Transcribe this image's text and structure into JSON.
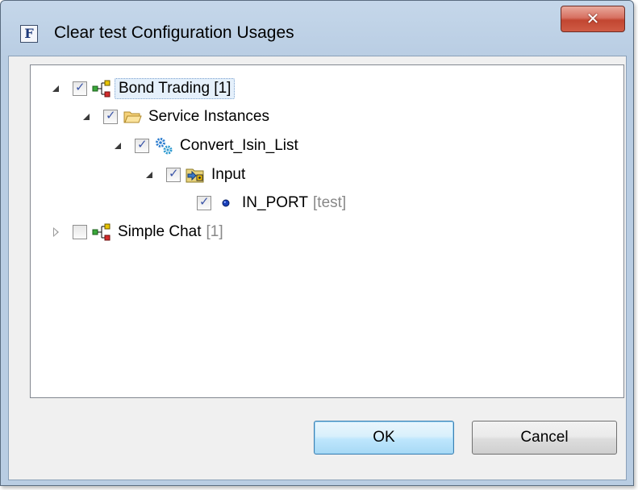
{
  "window": {
    "title": "Clear test Configuration Usages",
    "app_icon": "F",
    "close_glyph": "✕"
  },
  "tree": {
    "nodes": [
      {
        "label": "Bond Trading [1]",
        "suffix": "",
        "checked": true,
        "expanded": true,
        "icon": "project-icon",
        "selected": true
      },
      {
        "label": "Service Instances",
        "suffix": "",
        "checked": true,
        "expanded": true,
        "icon": "folder-open-icon"
      },
      {
        "label": "Convert_Isin_List",
        "suffix": "",
        "checked": true,
        "expanded": true,
        "icon": "gears-icon"
      },
      {
        "label": "Input",
        "suffix": "",
        "checked": true,
        "expanded": true,
        "icon": "input-folder-icon"
      },
      {
        "label": "IN_PORT",
        "suffix": "[test]",
        "checked": true,
        "expanded": null,
        "icon": "port-dot-icon"
      },
      {
        "label": "Simple Chat",
        "suffix": "[1]",
        "checked": false,
        "expanded": false,
        "icon": "project-icon"
      }
    ]
  },
  "buttons": {
    "ok": "OK",
    "cancel": "Cancel"
  },
  "colors": {
    "accent": "#3c7fb1",
    "close": "#c24631"
  }
}
